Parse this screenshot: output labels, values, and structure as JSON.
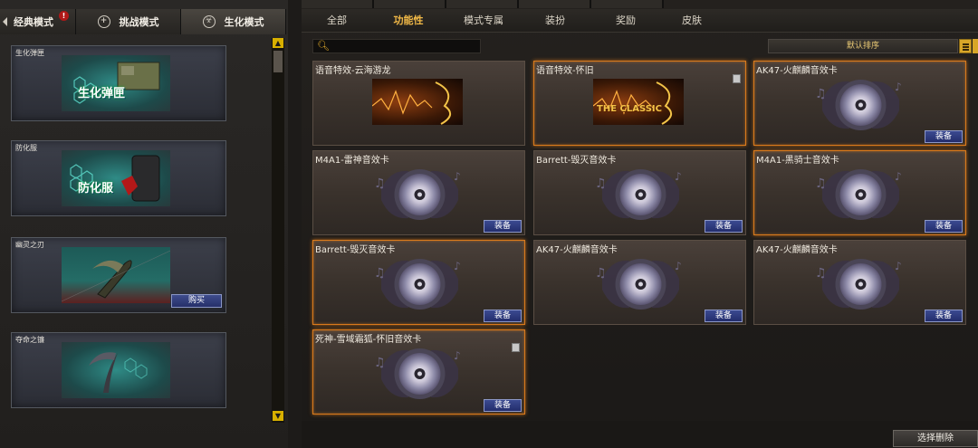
{
  "mode_tabs": [
    {
      "label": "经典模式",
      "alert": "!"
    },
    {
      "label": "挑战模式"
    },
    {
      "label": "生化模式",
      "active": true
    }
  ],
  "left_items": [
    {
      "title": "生化弹匣",
      "thumb_text": "生化弹匣"
    },
    {
      "title": "防化服",
      "thumb_text": "防化服"
    },
    {
      "title": "幽灵之刃",
      "button": "购买"
    },
    {
      "title": "夺命之镰"
    }
  ],
  "filter_tabs": [
    {
      "label": "全部"
    },
    {
      "label": "功能性",
      "active": true
    },
    {
      "label": "模式专属"
    },
    {
      "label": "装扮"
    },
    {
      "label": "奖励"
    },
    {
      "label": "皮肤"
    }
  ],
  "search": {
    "placeholder": ""
  },
  "sort": {
    "label": "默认排序"
  },
  "cards": [
    {
      "name": "语音特效-云海游龙",
      "image": "dragon-banner",
      "selected": false
    },
    {
      "name": "语音特效-怀旧",
      "image": "classic-banner",
      "banner_text": "THE CLASSIC",
      "selected": true,
      "trash": true
    },
    {
      "name": "AK47-火麒麟音效卡",
      "image": "disc",
      "button": "装备",
      "selected": true
    },
    {
      "name": "M4A1-雷神音效卡",
      "image": "disc",
      "button": "装备",
      "selected": false
    },
    {
      "name": "Barrett-毁灭音效卡",
      "image": "disc",
      "button": "装备",
      "selected": false
    },
    {
      "name": "M4A1-黑骑士音效卡",
      "image": "disc",
      "button": "装备",
      "selected": true
    },
    {
      "name": "Barrett-毁灭音效卡",
      "image": "disc",
      "button": "装备",
      "selected": true
    },
    {
      "name": "AK47-火麒麟音效卡",
      "image": "disc",
      "button": "装备",
      "selected": false
    },
    {
      "name": "AK47-火麒麟音效卡",
      "image": "disc",
      "button": "装备",
      "selected": false
    },
    {
      "name": "死神-雪域霜狐-怀旧音效卡",
      "image": "disc",
      "button": "装备",
      "selected": true,
      "trash": true
    }
  ],
  "bottom": {
    "delete_label": "选择删除"
  },
  "colors": {
    "accent": "#f0b847",
    "selected_border": "#d97a1c",
    "button_blue": "#2a367a"
  }
}
